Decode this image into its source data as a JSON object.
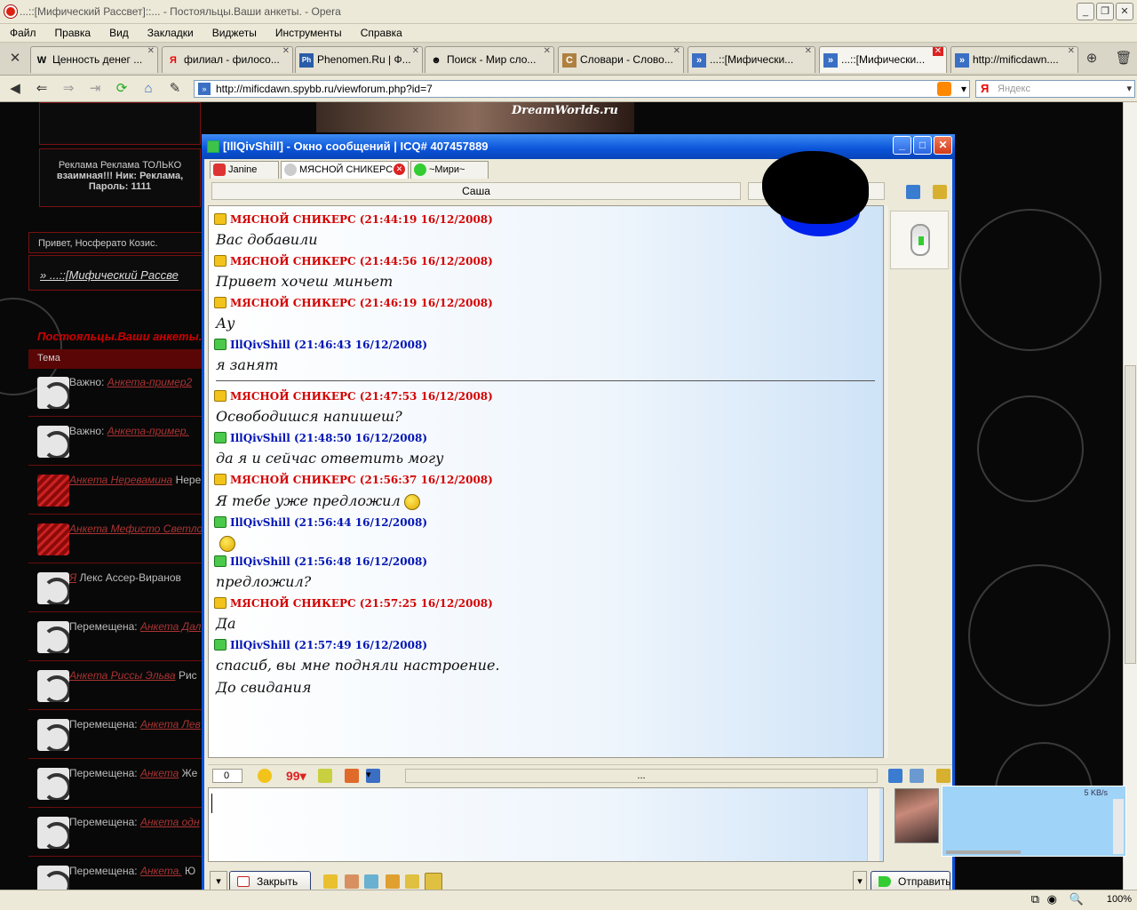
{
  "window": {
    "title": "...::[Мифический Рассвет]::... - Постояльцы.Ваши анкеты. - Opera"
  },
  "menu": [
    "Файл",
    "Правка",
    "Вид",
    "Закладки",
    "Виджеты",
    "Инструменты",
    "Справка"
  ],
  "tabs": [
    {
      "label": "Ценность денег ...",
      "icon": "W"
    },
    {
      "label": "филиал - филосо...",
      "icon": "Я"
    },
    {
      "label": "Phenomen.Ru | Ф...",
      "icon": "Ph"
    },
    {
      "label": "Поиск - Мир сло...",
      "icon": "☻"
    },
    {
      "label": "Словари - Слово...",
      "icon": "C"
    },
    {
      "label": "...::[Мифически...",
      "icon": "»"
    },
    {
      "label": "...::[Мифически...",
      "icon": "»"
    },
    {
      "label": "http://mificdawn....",
      "icon": "»"
    }
  ],
  "address": {
    "url": "http://mificdawn.spybb.ru/viewforum.php?id=7",
    "search_placeholder": "Яндекс"
  },
  "forum": {
    "banner": "DreamWorlds.ru",
    "ad_line1": "Реклама Реклама ТОЛЬКО",
    "ad_line2": "взаимная!!! Ник: Реклама,",
    "ad_line3": "Пароль: 1111",
    "greeting": "Привет, Носферато Козиc.",
    "breadcrumb": "» ...::[Мифический Рассве",
    "section": "Постояльцы.Ваши анкеты.",
    "col_header": "Тема",
    "rows": [
      {
        "prefix": "Важно: ",
        "link": "Анкета-пример2",
        "rest": ""
      },
      {
        "prefix": "Важно: ",
        "link": "Анкета-пример.",
        "rest": ""
      },
      {
        "prefix": "",
        "link": "Анкета Неревамина",
        "rest": " Нере"
      },
      {
        "prefix": "",
        "link": "Анкета Мефисто Светлого",
        "rest": ""
      },
      {
        "prefix": "",
        "link": "Я",
        "rest": "  Лекс Ассер-Виранов"
      },
      {
        "prefix": "Перемещена: ",
        "link": "Анкета Дал",
        "rest": ""
      },
      {
        "prefix": "",
        "link": "Анкета Риссы Эльва",
        "rest": "  Рис"
      },
      {
        "prefix": "Перемещена: ",
        "link": "Анкета Лев",
        "rest": ""
      },
      {
        "prefix": "Перемещена: ",
        "link": "Анкета",
        "rest": "  Же"
      },
      {
        "prefix": "Перемещена: ",
        "link": "Анкета одн",
        "rest": ""
      },
      {
        "prefix": "Перемещена: ",
        "link": "Анкета.",
        "rest": "  Ю"
      }
    ]
  },
  "icq": {
    "title": "[IllQivShill] - Окно сообщений | ICQ# 407457889",
    "contact_tabs": [
      "Janine",
      "МЯСНОЙ СНИКЕРС",
      "~Мири~"
    ],
    "name_field": "Саша",
    "messages": [
      {
        "who": "a",
        "header": "МЯСНОЙ СНИКЕРС  (21:44:19 16/12/2008)",
        "text": "Вас добавили"
      },
      {
        "who": "a",
        "header": "МЯСНОЙ СНИКЕРС  (21:44:56 16/12/2008)",
        "text": "Привет хочеш миньет"
      },
      {
        "who": "a",
        "header": "МЯСНОЙ СНИКЕРС  (21:46:19 16/12/2008)",
        "text": "Ау"
      },
      {
        "who": "b",
        "header": "IllQivShill (21:46:43 16/12/2008)",
        "text": "я занят"
      },
      {
        "who": "a",
        "header": "МЯСНОЙ СНИКЕРС  (21:47:53 16/12/2008)",
        "text": "Освободишся напишеш?"
      },
      {
        "who": "b",
        "header": "IllQivShill (21:48:50 16/12/2008)",
        "text": "да я и сейчас ответить могу"
      },
      {
        "who": "a",
        "header": "МЯСНОЙ СНИКЕРС  (21:56:37 16/12/2008)",
        "text": "Я тебе уже предложил"
      },
      {
        "who": "b",
        "header": "IllQivShill (21:56:44 16/12/2008)",
        "text": ""
      },
      {
        "who": "b",
        "header": "IllQivShill (21:56:48 16/12/2008)",
        "text": "предложил?"
      },
      {
        "who": "a",
        "header": "МЯСНОЙ СНИКЕРС  (21:57:25 16/12/2008)",
        "text": "Да"
      },
      {
        "who": "b",
        "header": "IllQivShill (21:57:49 16/12/2008)",
        "text": "спасиб, вы мне подняли настроение."
      },
      {
        "who": "b",
        "header": "",
        "text": "До свидания"
      }
    ],
    "char_count": "0",
    "ellipsis": "...",
    "close_label": "Закрыть",
    "send_label": "Отправить"
  },
  "notif": {
    "speed": "5 KB/s"
  },
  "status": {
    "zoom": "100%"
  }
}
